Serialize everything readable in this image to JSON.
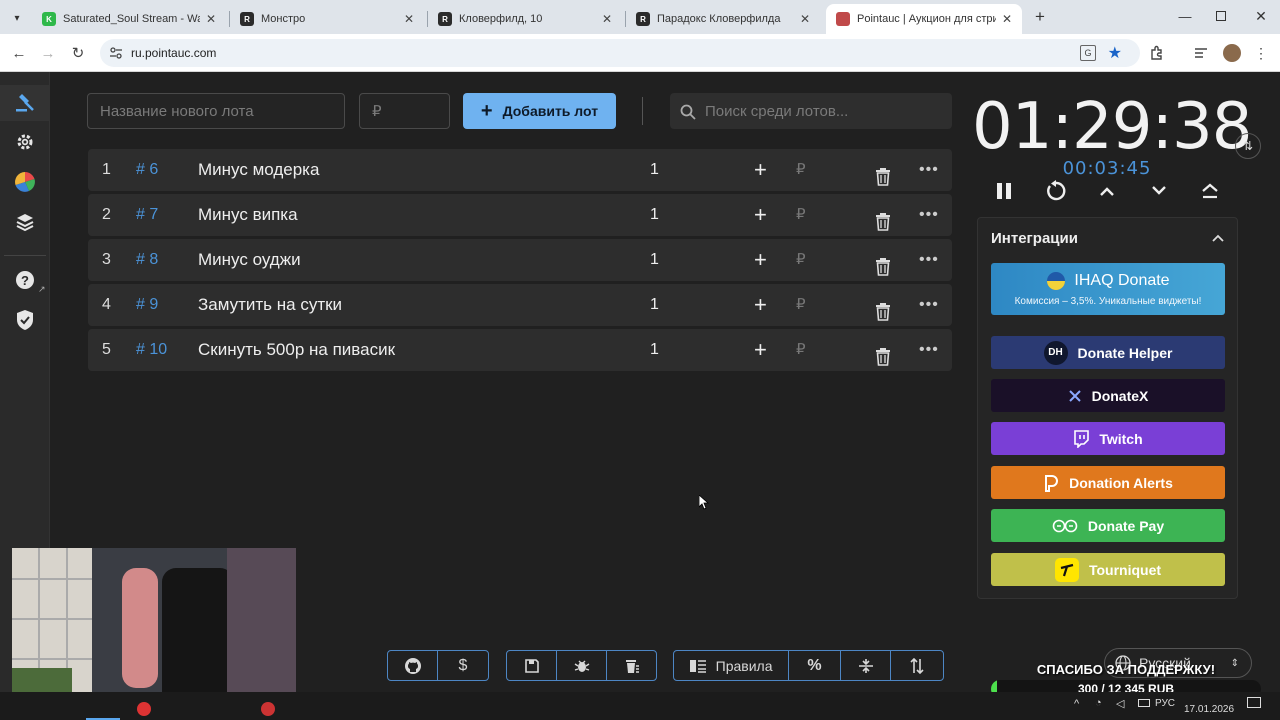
{
  "browser": {
    "tabs": [
      {
        "title": "Saturated_Soul Stream - Watch",
        "fav_color": "#2fb84a",
        "fav_letter": "K"
      },
      {
        "title": "Монстро",
        "fav_color": "#2b2b2b",
        "fav_letter": "R"
      },
      {
        "title": "Кловерфилд, 10",
        "fav_color": "#2b2b2b",
        "fav_letter": "R"
      },
      {
        "title": "Парадокс Кловерфилда",
        "fav_color": "#2b2b2b",
        "fav_letter": "R"
      },
      {
        "title": "Pointauc | Аукцион для стриме",
        "fav_color": "#c04a4a",
        "fav_letter": ""
      }
    ],
    "url": "ru.pointauc.com"
  },
  "toolbar": {
    "new_lot_placeholder": "Название нового лота",
    "price_placeholder": "₽",
    "add_label": "Добавить лот",
    "search_placeholder": "Поиск среди лотов..."
  },
  "lots": [
    {
      "index": "1",
      "id": "# 6",
      "name": "Минус модерка",
      "amount": "1"
    },
    {
      "index": "2",
      "id": "# 7",
      "name": "Минус випка",
      "amount": "1"
    },
    {
      "index": "3",
      "id": "# 8",
      "name": "Минус оуджи",
      "amount": "1"
    },
    {
      "index": "4",
      "id": "# 9",
      "name": "Замутить на сутки",
      "amount": "1"
    },
    {
      "index": "5",
      "id": "# 10",
      "name": "Скинуть 500р на пивасик",
      "amount": "1"
    }
  ],
  "lot_row": {
    "currency": "₽"
  },
  "timer": {
    "main": "01:29:38",
    "secondary": "00:03:45"
  },
  "integrations": {
    "title": "Интеграции",
    "ihaq": {
      "label": "IHAQ Donate",
      "sub": "Комиссия – 3,5%. Уникальные виджеты!"
    },
    "items": [
      {
        "label": "Donate Helper",
        "color": "#2b3a73",
        "icon": "dh-icon"
      },
      {
        "label": "DonateX",
        "color": "#1a1028",
        "icon": "x-icon"
      },
      {
        "label": "Twitch",
        "color": "#7a3fd6",
        "icon": "twitch-icon"
      },
      {
        "label": "Donation Alerts",
        "color": "#e0781d",
        "icon": "donation-alerts-icon"
      },
      {
        "label": "Donate Pay",
        "color": "#3db454",
        "icon": "donatepay-icon"
      },
      {
        "label": "Tourniquet",
        "color": "#c0c04a",
        "icon": "tourniquet-icon"
      }
    ]
  },
  "bottom": {
    "rules_label": "Правила",
    "percent_label": "%"
  },
  "language": {
    "label": "Русский"
  },
  "stream_overlay": {
    "thanks": "СПАСИБО ЗА ПОДДЕРЖКУ!",
    "goal": "300 / 12 345 RUB",
    "goal_progress": 0.024
  },
  "taskbar": {
    "lang": "РУС",
    "date": "17.01.2026"
  }
}
